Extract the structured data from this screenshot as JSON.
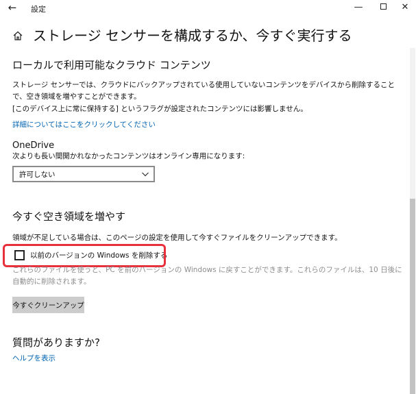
{
  "window": {
    "title": "設定",
    "back_glyph": "←",
    "min_glyph": "—",
    "close_glyph": "✕"
  },
  "header": {
    "title": "ストレージ センサーを構成するか、今すぐ実行する"
  },
  "cloud_section": {
    "title": "ローカルで利用可能なクラウド コンテンツ",
    "description": "ストレージ センサーでは、クラウドにバックアップされている使用していないコンテンツをデバイスから削除することで、空き領域を増やすことができます。",
    "note": "[このデバイス上に常に保持する] というフラグが設定されたコンテンツには影響しません。",
    "link": "詳細についてはここをクリックしてください"
  },
  "onedrive": {
    "title": "OneDrive",
    "description": "次よりも長い間開かれなかったコンテンツはオンライン専用になります:",
    "dropdown_value": "許可しない"
  },
  "free_space": {
    "title": "今すぐ空き領域を増やす",
    "description": "領域が不足している場合は、このページの設定を使用して今すぐファイルをクリーンアップできます。",
    "checkbox_label": "以前のバージョンの Windows を削除する",
    "checkbox_checked": false,
    "checkbox_note": "これらのファイルを使うと、PC を前のバージョンの Windows に戻すことができます。これらのファイルは、10 日後に自動的に削除されます。",
    "button_label": "今すぐクリーンアップ"
  },
  "questions": {
    "title": "質問がありますか?",
    "link": "ヘルプを表示"
  },
  "colors": {
    "link": "#0063b1",
    "highlight": "#e8303c",
    "button_bg": "#cccccc",
    "muted_text": "#8d8d8d"
  }
}
